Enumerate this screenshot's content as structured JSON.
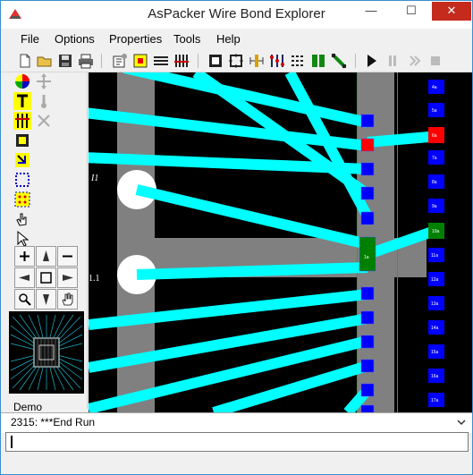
{
  "window": {
    "title": "AsPacker Wire Bond Explorer",
    "minimize": "—",
    "maximize": "☐",
    "close": "✕",
    "close_color": "#c42b1c"
  },
  "menu": {
    "items": [
      "File",
      "Options",
      "Properties",
      "Tools",
      "Help"
    ]
  },
  "toolbar": {
    "icons": [
      "new-file-icon",
      "open-folder-icon",
      "save-icon",
      "print-icon",
      "properties-icon",
      "add-pad-icon",
      "wire-bundle-icon",
      "bond-fingers-icon",
      "select-die-icon",
      "die-outline-icon",
      "measure-icon",
      "align-icon",
      "grid-icon",
      "pad-array-icon",
      "green-column-icon",
      "route-icon",
      "run-icon",
      "pause-icon",
      "step-icon",
      "stop-icon"
    ]
  },
  "palette": {
    "tools": [
      "color-wheel-icon",
      "move-icon",
      "text-tool-icon",
      "pin-tool-icon",
      "columns-tool-icon",
      "delete-tool-icon",
      "chip-tool-icon",
      "bond-tool-icon",
      "select-box-icon",
      "pad-select-icon",
      "hand-pointer-icon",
      "arrow-pointer-icon"
    ],
    "navigation": [
      "zoom-in-icon",
      "pan-up-icon",
      "zoom-out-icon",
      "pan-left-icon",
      "fit-view-icon",
      "pan-right-icon",
      "zoom-window-icon",
      "pan-down-icon",
      "grab-icon"
    ],
    "preview_label": "Demo"
  },
  "canvas": {
    "colors": {
      "background": "#000000",
      "trace": "#808080",
      "wire": "#00ffff",
      "pad": "#0000ff",
      "pad_alt_red": "#ff0000",
      "pad_alt_green": "#008000",
      "via": "#ffffff"
    },
    "labels": {
      "via_label_1": "I1",
      "via_label_2": "1.1",
      "green_pad_label": "1a",
      "right_pads": [
        "4a",
        "5a",
        "6a",
        "7a",
        "8a",
        "9a",
        "10a",
        "11a",
        "12a",
        "13a",
        "14a",
        "15a",
        "16a",
        "17a"
      ]
    }
  },
  "status": {
    "message": "2315: ***End Run"
  },
  "command": {
    "value": ""
  }
}
